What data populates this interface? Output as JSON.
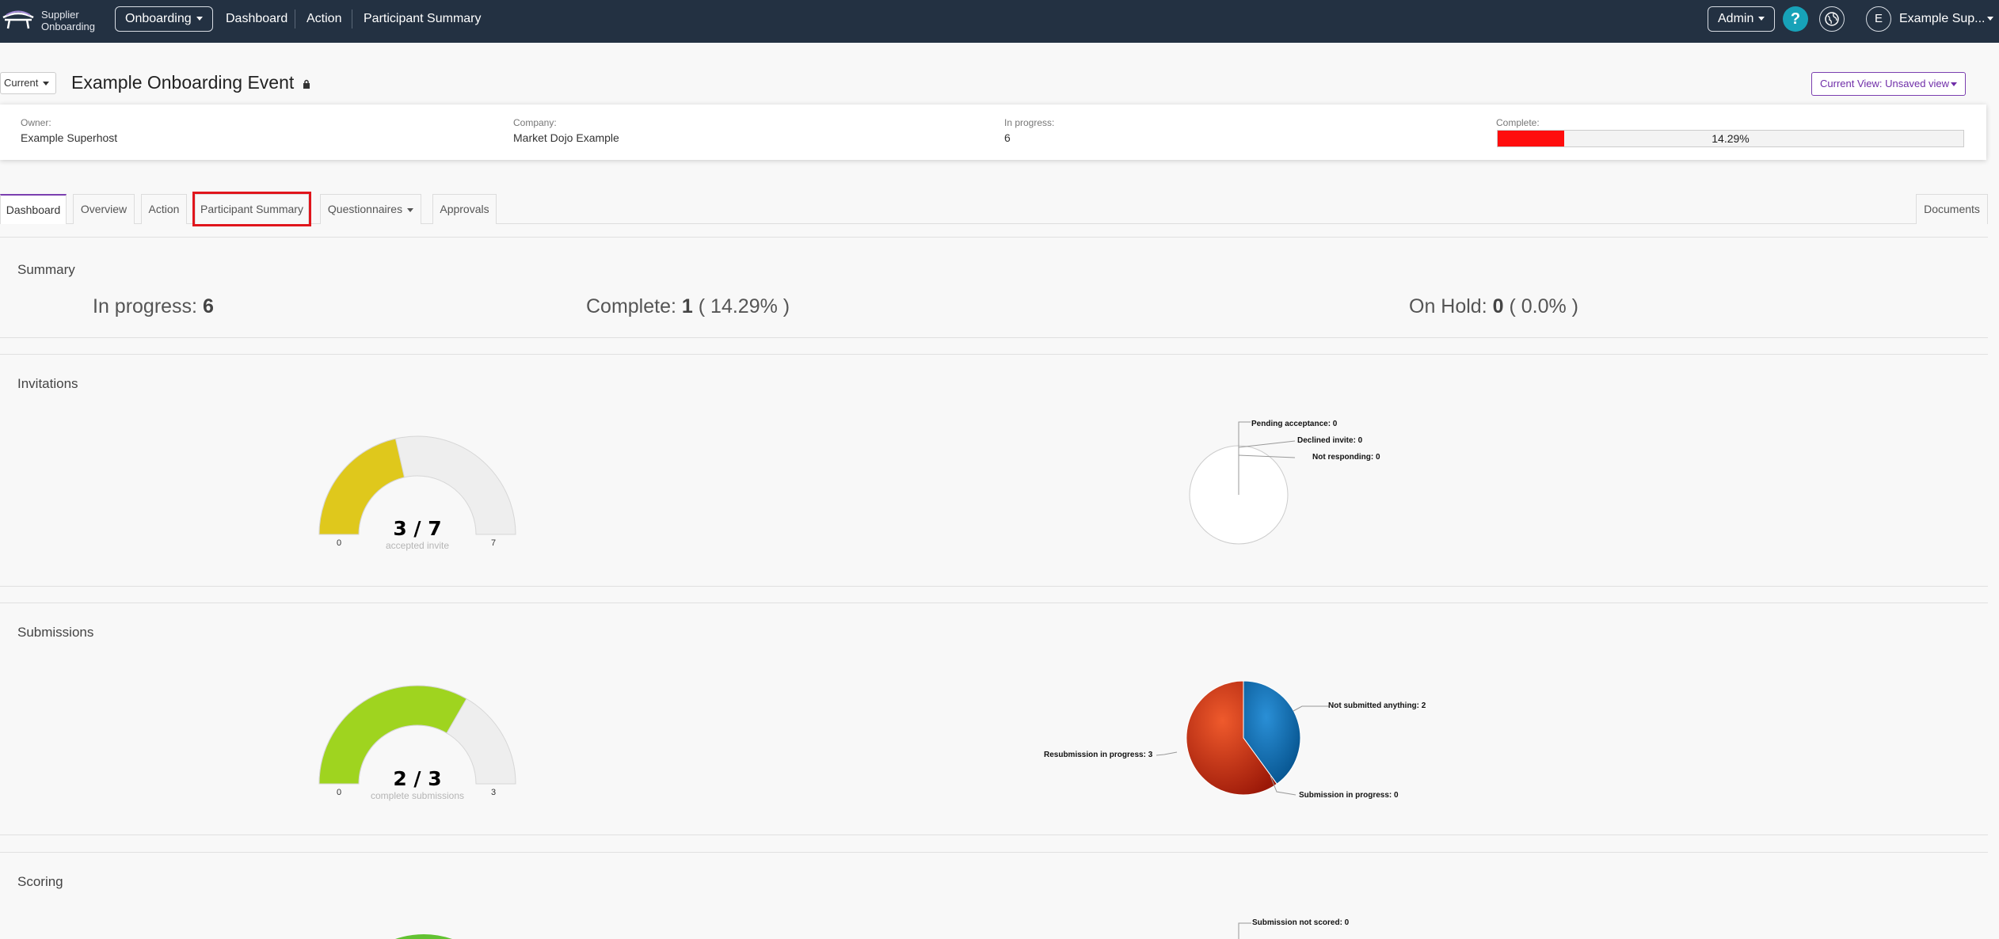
{
  "topbar": {
    "logo_line1": "Supplier",
    "logo_line2": "Onboarding",
    "module_dropdown": "Onboarding",
    "links": [
      "Dashboard",
      "Action",
      "Participant Summary"
    ],
    "admin_label": "Admin",
    "help_glyph": "?",
    "avatar_initial": "E",
    "user_name": "Example Sup...",
    "icons": [
      "logo-icon",
      "help-icon",
      "globe-icon"
    ]
  },
  "header": {
    "version_select": "Current",
    "event_title": "Example Onboarding Event",
    "view_button": "Current View: Unsaved view"
  },
  "info": {
    "owner_label": "Owner:",
    "owner_value": "Example Superhost",
    "company_label": "Company:",
    "company_value": "Market Dojo Example",
    "inprogress_label": "In progress:",
    "inprogress_value": "6",
    "complete_label": "Complete:",
    "complete_percent_text": "14.29%",
    "complete_fraction": 0.1429
  },
  "tabs": {
    "dashboard": "Dashboard",
    "overview": "Overview",
    "action": "Action",
    "participant_summary": "Participant Summary",
    "questionnaires": "Questionnaires",
    "approvals": "Approvals",
    "documents": "Documents"
  },
  "summary": {
    "title": "Summary",
    "in_progress_label": "In progress:",
    "in_progress_value": "6",
    "complete_label": "Complete:",
    "complete_value": "1",
    "complete_pct": "( 14.29% )",
    "on_hold_label": "On Hold:",
    "on_hold_value": "0",
    "on_hold_pct": "( 0.0% )"
  },
  "invitations": {
    "title": "Invitations",
    "gauge_text": "3 / 7",
    "gauge_caption": "accepted invite",
    "gauge_min": "0",
    "gauge_max": "7",
    "pie_labels": [
      "Pending acceptance: 0",
      "Declined invite: 0",
      "Not responding: 0"
    ]
  },
  "submissions": {
    "title": "Submissions",
    "gauge_text": "2 / 3",
    "gauge_caption": "complete submissions",
    "gauge_min": "0",
    "gauge_max": "3",
    "pie_labels": {
      "not_submitted": "Not submitted anything: 2",
      "resubmission": "Resubmission in progress: 3",
      "in_progress": "Submission in progress: 0"
    }
  },
  "scoring": {
    "title": "Scoring",
    "pie_label": "Submission not scored: 0"
  },
  "chart_data": [
    {
      "type": "gauge",
      "title": "Invitations",
      "value": 3,
      "min": 0,
      "max": 7,
      "color": "#dfc81c"
    },
    {
      "type": "pie",
      "title": "Invitations",
      "categories": [
        "Pending acceptance",
        "Declined invite",
        "Not responding"
      ],
      "values": [
        0,
        0,
        0
      ]
    },
    {
      "type": "gauge",
      "title": "Submissions",
      "value": 2,
      "min": 0,
      "max": 3,
      "color": "#9fd41f"
    },
    {
      "type": "pie",
      "title": "Submissions",
      "categories": [
        "Not submitted anything",
        "Resubmission in progress",
        "Submission in progress"
      ],
      "values": [
        2,
        3,
        0
      ],
      "colors": [
        "#0b72b5",
        "#d8361a",
        "#888888"
      ]
    }
  ],
  "colors": {
    "topbar": "#233142",
    "accent_purple": "#7b3fb0",
    "progress_red": "#ff0d0d",
    "highlight_red": "#e0151c",
    "help_teal": "#17a2b8"
  }
}
